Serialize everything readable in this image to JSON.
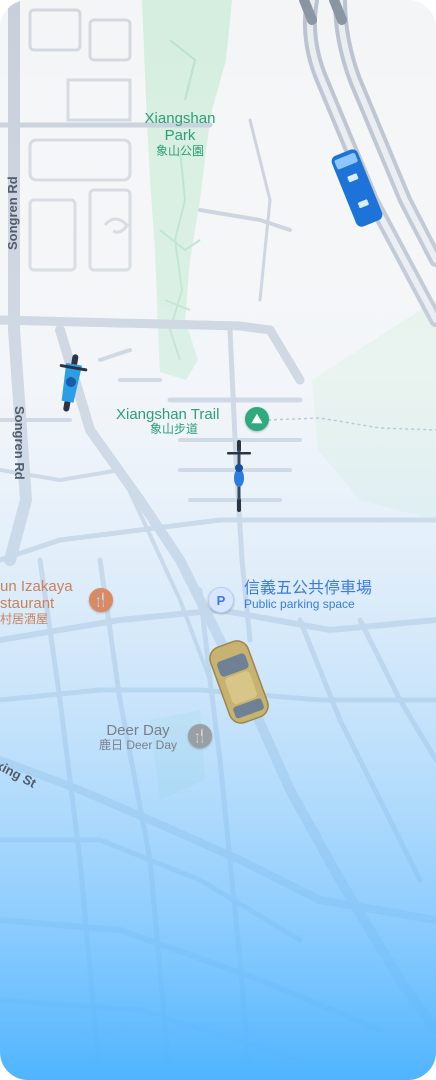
{
  "map": {
    "labels": {
      "park": {
        "name": "Xiangshan Park",
        "name_line1": "Xiangshan",
        "name_line2": "Park",
        "local": "象山公園"
      },
      "trail": {
        "name": "Xiangshan Trail",
        "local": "象山步道"
      },
      "izakaya": {
        "name_line1": "un Izakaya",
        "name_line2": "staurant",
        "local": "村居酒屋"
      },
      "parking": {
        "name": "信義五公共停車場",
        "subtitle": "Public parking space"
      },
      "deer_day": {
        "name": "Deer Day",
        "local": "鹿日 Deer Day"
      },
      "roads": {
        "songren_upper": "Songren Rd",
        "songren_lower": "Songren Rd",
        "xing_st": "xing St"
      }
    },
    "icons": {
      "parking_glyph": "P",
      "park_icon": "hiking-icon",
      "restaurant_icon": "fork-knife-icon"
    },
    "vehicles": [
      "bus",
      "motorcycle",
      "bicycle",
      "car"
    ],
    "colors": {
      "road": "#c7cfdb",
      "park": "#d8efe2",
      "water_gradient_bottom": "#4fb4ff",
      "park_text": "#2e9e78",
      "poi_orange": "#c9815c",
      "poi_blue": "#3b7be0"
    }
  }
}
